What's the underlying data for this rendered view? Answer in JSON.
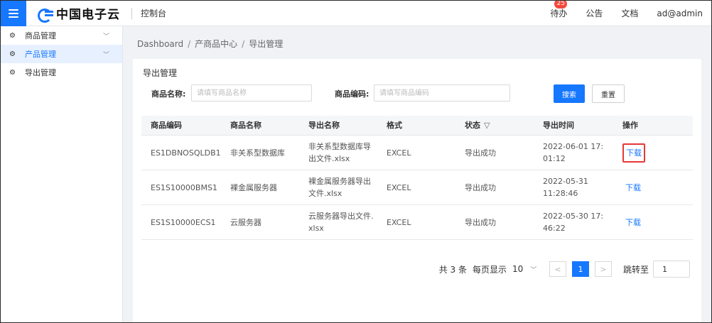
{
  "header": {
    "brand": "中国电子云",
    "console_label": "控制台",
    "todo_label": "待办",
    "todo_badge": "25",
    "notice_label": "公告",
    "docs_label": "文档",
    "user": "ad@admin"
  },
  "sidebar": {
    "items": [
      {
        "label": "商品管理",
        "icon": "gear-icon",
        "has_chevron": true,
        "active": false
      },
      {
        "label": "产品管理",
        "icon": "gear-icon",
        "has_chevron": true,
        "active": true
      },
      {
        "label": "导出管理",
        "icon": "gear-icon",
        "has_chevron": false,
        "active": false
      }
    ]
  },
  "breadcrumb": [
    "Dashboard",
    "产商品中心",
    "导出管理"
  ],
  "card": {
    "title": "导出管理",
    "filters": {
      "name_label": "商品名称:",
      "name_placeholder": "请填写商品名称",
      "code_label": "商品编码:",
      "code_placeholder": "请填写商品编码",
      "search_label": "搜索",
      "reset_label": "重置"
    },
    "table": {
      "headers": [
        "商品编码",
        "商品名称",
        "导出名称",
        "格式",
        "状态",
        "导出时间",
        "操作"
      ],
      "rows": [
        {
          "code": "ES1DBNOSQLDB1",
          "name": "非关系型数据库",
          "export_name": "非关系型数据库导出文件.xlsx",
          "format": "EXCEL",
          "status": "导出成功",
          "time": "2022-06-01 17:01:12",
          "action": "下载"
        },
        {
          "code": "ES1S10000BMS1",
          "name": "裸金属服务器",
          "export_name": "裸金属服务器导出文件.xlsx",
          "format": "EXCEL",
          "status": "导出成功",
          "time": "2022-05-31 11:28:46",
          "action": "下载"
        },
        {
          "code": "ES1S10000ECS1",
          "name": "云服务器",
          "export_name": "云服务器导出文件.xlsx",
          "format": "EXCEL",
          "status": "导出成功",
          "time": "2022-05-30 17:46:22",
          "action": "下载"
        }
      ]
    },
    "pagination": {
      "total": "共 3 条",
      "page_size_label": "每页显示",
      "page_size": "10",
      "prev": "<",
      "current": "1",
      "next": ">",
      "jump_label": "跳转至",
      "jump_value": "1"
    }
  },
  "colors": {
    "primary": "#1677ff",
    "badge": "#f5483b",
    "highlight": "#e53935"
  }
}
